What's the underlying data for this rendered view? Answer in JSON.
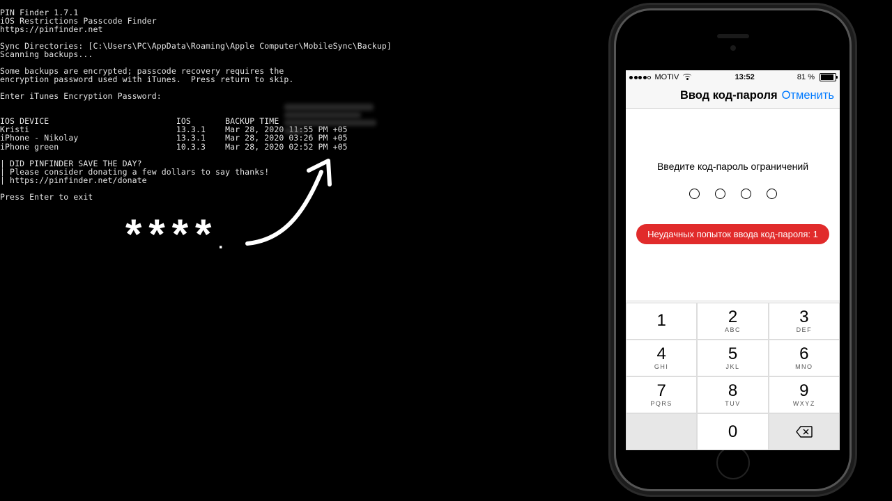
{
  "terminal": {
    "app_name": "PIN Finder 1.7.1",
    "subtitle": "iOS Restrictions Passcode Finder",
    "url": "https://pinfinder.net",
    "sync_line": "Sync Directories: [C:\\Users\\PC\\AppData\\Roaming\\Apple Computer\\MobileSync\\Backup]",
    "scan_line": "Scanning backups...",
    "enc_line1": "Some backups are encrypted; passcode recovery requires the",
    "enc_line2": "encryption password used with iTunes.  Press return to skip.",
    "pw_prompt": "Enter iTunes Encryption Password:",
    "hdr_device": "IOS DEVICE",
    "hdr_ios": "IOS",
    "hdr_time": "BACKUP TIME",
    "rows": [
      {
        "d": "Kristi",
        "v": "13.3.1",
        "t": "Mar 28, 2020 11:55 PM +05"
      },
      {
        "d": "iPhone - Nikolay",
        "v": "13.3.1",
        "t": "Mar 28, 2020 03:26 PM +05"
      },
      {
        "d": "iPhone green",
        "v": "10.3.3",
        "t": "Mar 28, 2020 02:52 PM +05"
      }
    ],
    "ask1": "| DID PINFINDER SAVE THE DAY?",
    "ask2": "| Please consider donating a few dollars to say thanks!",
    "ask3": "| https://pinfinder.net/donate",
    "exit": "Press Enter to exit"
  },
  "overlay": {
    "stars": "****"
  },
  "phone": {
    "carrier": "MOTIV",
    "time": "13:52",
    "battery_pct": "81 %",
    "nav_title": "Ввод код-пароля",
    "nav_cancel": "Отменить",
    "prompt": "Введите код-пароль ограничений",
    "error": "Неудачных попыток ввода код-пароля: 1",
    "keys": [
      {
        "n": "1",
        "l": ""
      },
      {
        "n": "2",
        "l": "ABC"
      },
      {
        "n": "3",
        "l": "DEF"
      },
      {
        "n": "4",
        "l": "GHI"
      },
      {
        "n": "5",
        "l": "JKL"
      },
      {
        "n": "6",
        "l": "MNO"
      },
      {
        "n": "7",
        "l": "PQRS"
      },
      {
        "n": "8",
        "l": "TUV"
      },
      {
        "n": "9",
        "l": "WXYZ"
      },
      {
        "n": "",
        "l": ""
      },
      {
        "n": "0",
        "l": ""
      },
      {
        "n": "",
        "l": ""
      }
    ]
  }
}
